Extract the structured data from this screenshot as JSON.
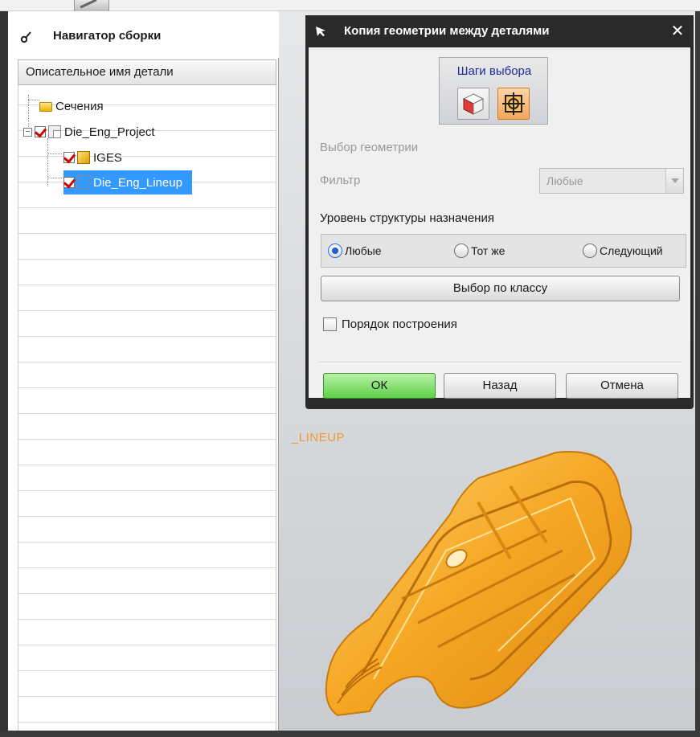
{
  "navigator": {
    "title": "Навигатор сборки",
    "column_header": "Описательное имя детали",
    "tree": [
      {
        "label": "Сечения",
        "icon": "folder-icon"
      },
      {
        "label": "Die_Eng_Project",
        "icon": "assembly-icon",
        "checked": true,
        "expanded": true
      },
      {
        "label": "IGES",
        "icon": "part-icon",
        "checked": true
      },
      {
        "label": "Die_Eng_Lineup",
        "icon": "wireframe-part-icon",
        "checked": true,
        "selected": true
      }
    ]
  },
  "dialog": {
    "title": "Копия геометрии между деталями",
    "selection_steps_label": "Шаги выбора",
    "select_geometry_label": "Выбор геометрии",
    "filter_label": "Фильтр",
    "filter_value": "Любые",
    "structure_level_label": "Уровень структуры назначения",
    "radio_options": [
      "Любые",
      "Тот же",
      "Следующий"
    ],
    "radio_selected": "Любые",
    "class_selection_button": "Выбор по классу",
    "build_order_label": "Порядок построения",
    "ok_button": "ОК",
    "back_button": "Назад",
    "cancel_button": "Отмена"
  },
  "viewport": {
    "part_label": "_LINEUP",
    "part_color": "#f5a623"
  },
  "colors": {
    "selection": "#3399ff",
    "ok_button": "#5ecf48",
    "checkmark": "#d10000",
    "dialog_title_bar": "#2a2a2a"
  }
}
